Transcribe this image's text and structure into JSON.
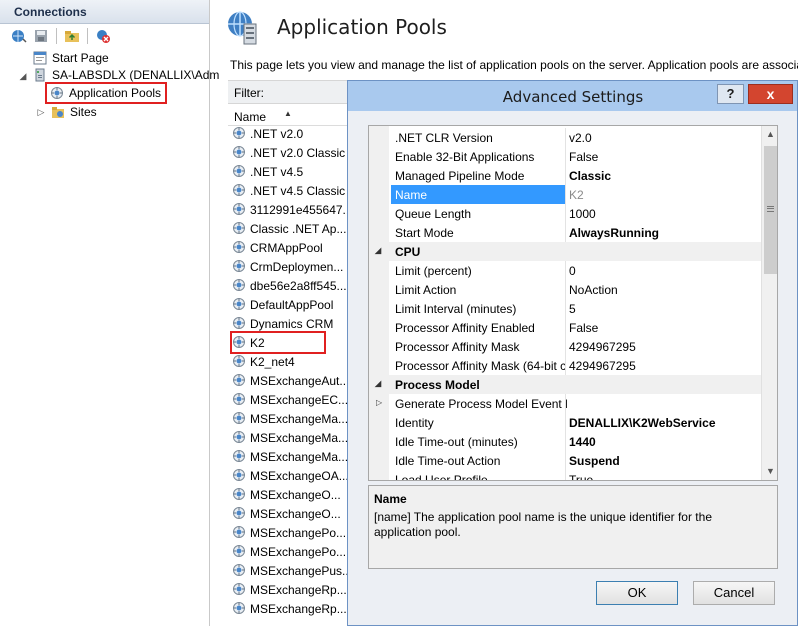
{
  "connections": {
    "header": "Connections",
    "tree": {
      "start_page": "Start Page",
      "server": "SA-LABSDLX (DENALLIX\\Adm",
      "app_pools": "Application Pools",
      "sites": "Sites"
    }
  },
  "main": {
    "title": "Application Pools",
    "description": "This page lets you view and manage the list of application pools on the server. Application pools are associa",
    "filter_label": "Filter:",
    "column_name": "Name",
    "pools": [
      ".NET v2.0",
      ".NET v2.0 Classic",
      ".NET v4.5",
      ".NET v4.5 Classic",
      "3112991e455647...",
      "Classic .NET Ap...",
      "CRMAppPool",
      "CrmDeploymen...",
      "dbe56e2a8ff545...",
      "DefaultAppPool",
      "Dynamics CRM",
      "K2",
      "K2_net4",
      "MSExchangeAut...",
      "MSExchangeEC...",
      "MSExchangeMa...",
      "MSExchangeMa...",
      "MSExchangeMa...",
      "MSExchangeOA...",
      "MSExchangeO...",
      "MSExchangeO...",
      "MSExchangePo...",
      "MSExchangePo...",
      "MSExchangePus...",
      "MSExchangeRp...",
      "MSExchangeRp..."
    ],
    "selected_pool_index": 11
  },
  "dialog": {
    "title": "Advanced Settings",
    "help": "?",
    "close": "x",
    "rows": [
      {
        "kind": "prop",
        "name": ".NET CLR Version",
        "value": "v2.0",
        "bold": false
      },
      {
        "kind": "prop",
        "name": "Enable 32-Bit Applications",
        "value": "False",
        "bold": false
      },
      {
        "kind": "prop",
        "name": "Managed Pipeline Mode",
        "value": "Classic",
        "bold": true
      },
      {
        "kind": "prop",
        "name": "Name",
        "value": "K2",
        "bold": false,
        "selected": true
      },
      {
        "kind": "prop",
        "name": "Queue Length",
        "value": "1000",
        "bold": false
      },
      {
        "kind": "prop",
        "name": "Start Mode",
        "value": "AlwaysRunning",
        "bold": true
      },
      {
        "kind": "cat",
        "name": "CPU"
      },
      {
        "kind": "prop",
        "name": "Limit (percent)",
        "value": "0",
        "bold": false
      },
      {
        "kind": "prop",
        "name": "Limit Action",
        "value": "NoAction",
        "bold": false
      },
      {
        "kind": "prop",
        "name": "Limit Interval (minutes)",
        "value": "5",
        "bold": false
      },
      {
        "kind": "prop",
        "name": "Processor Affinity Enabled",
        "value": "False",
        "bold": false
      },
      {
        "kind": "prop",
        "name": "Processor Affinity Mask",
        "value": "4294967295",
        "bold": false
      },
      {
        "kind": "prop",
        "name": "Processor Affinity Mask (64-bit c",
        "value": "4294967295",
        "bold": false
      },
      {
        "kind": "cat",
        "name": "Process Model"
      },
      {
        "kind": "prop",
        "name": "Generate Process Model Event L",
        "value": "",
        "bold": false,
        "collapsed": true
      },
      {
        "kind": "prop",
        "name": "Identity",
        "value": "DENALLIX\\K2WebService",
        "bold": true
      },
      {
        "kind": "prop",
        "name": "Idle Time-out (minutes)",
        "value": "1440",
        "bold": true
      },
      {
        "kind": "prop",
        "name": "Idle Time-out Action",
        "value": "Suspend",
        "bold": true
      },
      {
        "kind": "prop",
        "name": "Load User Profile",
        "value": "True",
        "bold": false
      }
    ],
    "description": {
      "title": "Name",
      "text": "[name] The application pool name is the unique identifier for the application pool."
    },
    "ok_label": "OK",
    "cancel_label": "Cancel"
  },
  "colors": {
    "accent_red": "#e02020",
    "selection_blue": "#3399ff",
    "title_bar": "#a9c9ee"
  }
}
